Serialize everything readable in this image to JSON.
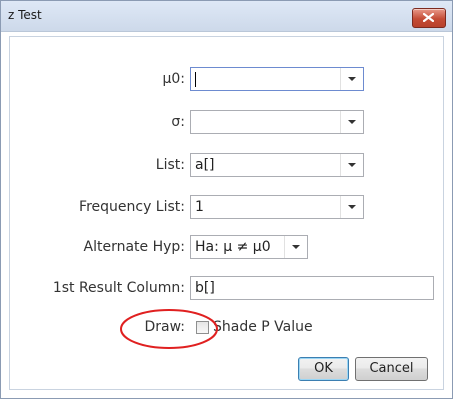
{
  "window": {
    "title": "z Test"
  },
  "fields": {
    "mu0": {
      "label": "µ0:",
      "value": ""
    },
    "sigma": {
      "label": "σ:",
      "value": ""
    },
    "list": {
      "label": "List:",
      "value": "a[]"
    },
    "freq": {
      "label": "Frequency List:",
      "value": "1"
    },
    "alt": {
      "label": "Alternate Hyp:",
      "value": "Ha: µ ≠ µ0"
    },
    "result": {
      "label": "1st Result Column:",
      "value": "b[]"
    },
    "draw": {
      "label": "Draw:",
      "checkbox_label": "Shade P Value",
      "checked": false
    }
  },
  "buttons": {
    "ok": "OK",
    "cancel": "Cancel"
  },
  "annotation": {
    "color": "#e02020"
  }
}
